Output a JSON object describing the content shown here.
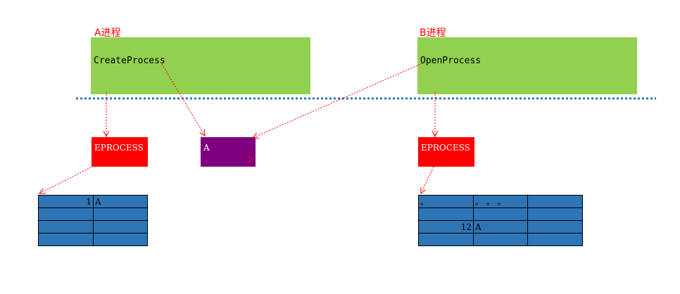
{
  "process_a": {
    "label": "A进程",
    "call": "CreateProcess",
    "eprocess": "EPROCESS"
  },
  "process_b": {
    "label": "B进程",
    "call": "OpenProcess",
    "eprocess": "EPROCESS"
  },
  "kernel_object": {
    "name": "A",
    "ref_count": "2"
  },
  "handle_table_a": [
    [
      "1",
      "A"
    ],
    [
      "",
      ""
    ],
    [
      "",
      ""
    ],
    [
      "",
      ""
    ]
  ],
  "handle_table_b": [
    [
      "。",
      "。 。 。",
      ""
    ],
    [
      "",
      "",
      ""
    ],
    [
      "12",
      "A",
      ""
    ],
    [
      "",
      "",
      ""
    ]
  ],
  "colors": {
    "process_box": "#92d050",
    "eprocess": "#ff0000",
    "kernel_object": "#7f007f",
    "handle_table": "#2e75b6",
    "divider": "#2e75b6",
    "arrow": "#ff0000"
  }
}
